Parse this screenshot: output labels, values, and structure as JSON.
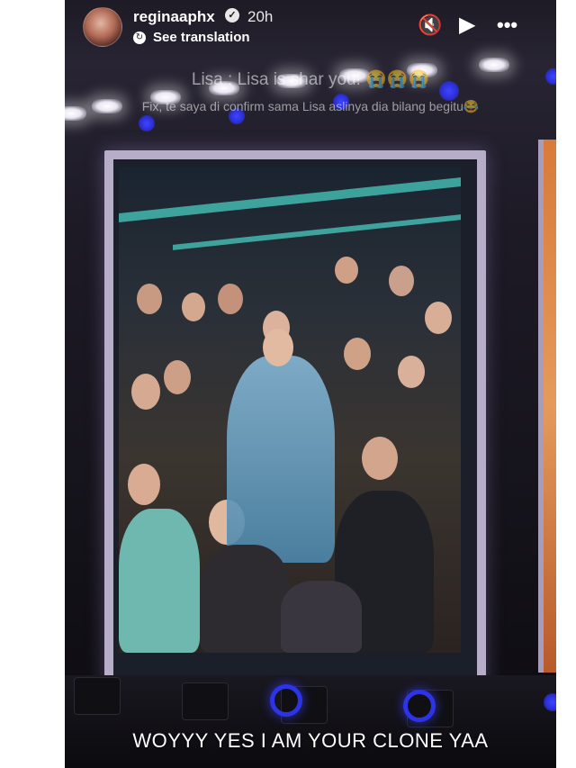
{
  "story": {
    "username": "reginaaphx",
    "verified_glyph": "✓",
    "time": "20h",
    "translate_icon_glyph": "↻",
    "see_translation": "See translation",
    "controls": {
      "mute_icon": "🔇",
      "play_icon": "▶",
      "more_icon": "•••"
    }
  },
  "captions": {
    "line1": "Lisa : Lisa is shar you! 😭😭😭",
    "line2": "Fix, te saya di confirm sama Lisa aslinya dia bilang begitu😂",
    "bottom": "WOYYY YES I AM YOUR CLONE YAA"
  },
  "colors": {
    "stage_bg": "#1d1a26",
    "frame": "#b7adc8",
    "accent_blue": "#2d33e6",
    "stripe_teal": "#46c2b8"
  }
}
